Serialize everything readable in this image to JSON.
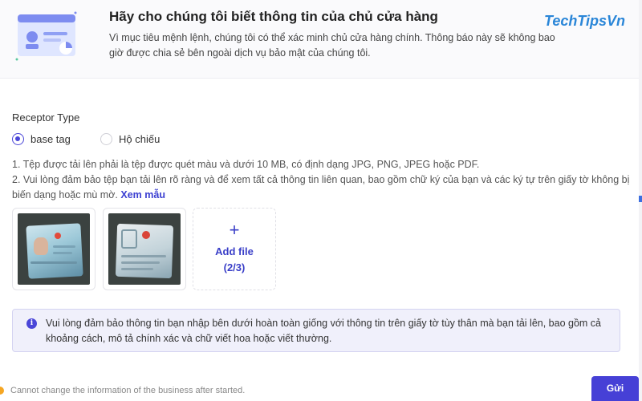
{
  "header": {
    "title": "Hãy cho chúng tôi biết thông tin của chủ cửa hàng",
    "description": "Vì mục tiêu mệnh lệnh, chúng tôi có thể xác minh chủ cửa hàng chính. Thông báo này sẽ không bao giờ được chia sẻ bên ngoài dịch vụ bảo mật của chúng tôi.",
    "watermark": "TechTipsVn"
  },
  "receptor": {
    "label": "Receptor Type",
    "options": [
      {
        "label": "base tag",
        "selected": true
      },
      {
        "label": "Hộ chiếu",
        "selected": false
      }
    ]
  },
  "notes": {
    "line1": "1. Tệp được tải lên phải là tệp được quét màu và dưới 10 MB, có định dạng JPG, PNG, JPEG hoặc PDF.",
    "line2": "2. Vui lòng đảm bảo tệp bạn tải lên rõ ràng và để xem tất cả thông tin liên quan, bao gồm chữ ký của bạn và các ký tự trên giấy tờ không bị biến dạng hoặc mù mờ.",
    "link": "Xem mẫu"
  },
  "upload": {
    "add_label": "Add file",
    "count": "(2/3)"
  },
  "info": {
    "text": "Vui lòng đảm bảo thông tin bạn nhập bên dưới hoàn toàn giống với thông tin trên giấy tờ tùy thân mà bạn tải lên, bao gồm cả khoảng cách, mô tả chính xác và chữ viết hoa hoặc viết thường."
  },
  "footer": {
    "warning": "Cannot change the information of the business after started.",
    "submit_label": "Gửi"
  },
  "colors": {
    "accent": "#4a46d8",
    "watermark": "#2a86d8",
    "warning": "#f5a623"
  }
}
